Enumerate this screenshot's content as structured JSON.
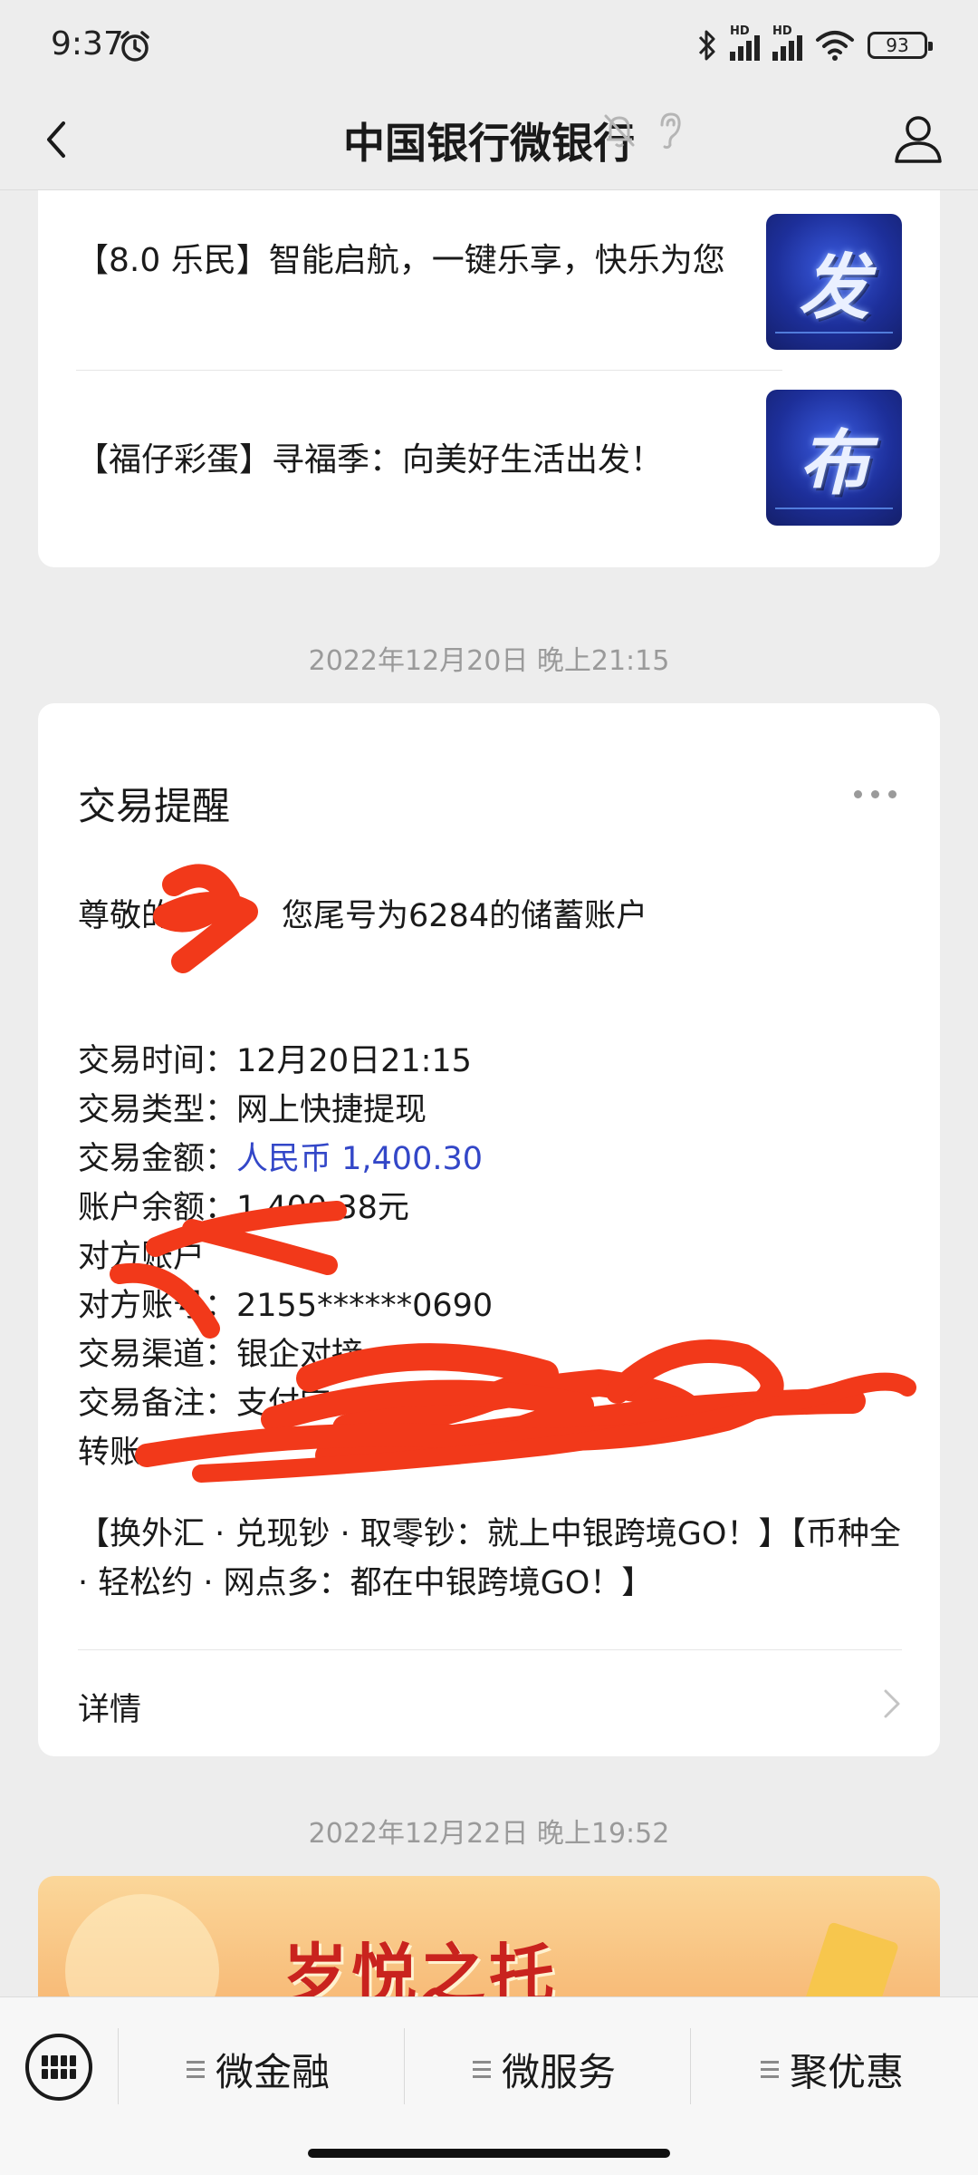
{
  "status_bar": {
    "time": "9:37",
    "signal_label_1": "HD",
    "signal_label_2": "HD",
    "battery": "93"
  },
  "header": {
    "title": "中国银行微银行"
  },
  "news": {
    "items": [
      {
        "title": "【8.0 乐民】智能启航，一键乐享，快乐为您",
        "thumb_glyph": "发"
      },
      {
        "title": "【福仔彩蛋】寻福季：向美好生活出发！",
        "thumb_glyph": "布"
      }
    ]
  },
  "timestamps": {
    "first": "2022年12月20日 晚上21:15",
    "second": "2022年12月22日 晚上19:52"
  },
  "transaction": {
    "title": "交易提醒",
    "greeting": "尊敬的……您尾号为6284的储蓄账户",
    "greeting_prefix": "尊敬的",
    "greeting_suffix": "您尾号为6284的储蓄账户",
    "time_label": "交易时间：",
    "time_value": "12月20日21:15",
    "type_label": "交易类型：",
    "type_value": "网上快捷提现",
    "amount_label": "交易金额：",
    "amount_value": "人民币 1,400.30",
    "balance_label": "账户余额：",
    "balance_value": "1,400.38元",
    "counterparty_label": "对方账户",
    "counterparty_no_label": "对方账号：",
    "counterparty_no_value": "2155******0690",
    "channel_label": "交易渠道：",
    "channel_value": "银企对接",
    "remark_label": "交易备注：",
    "remark_value": "支付宝",
    "remark_tail": "转账",
    "promo": "【换外汇 · 兑现钞 · 取零钞：就上中银跨境GO！】【币种全 · 轻松约 · 网点多：都在中银跨境GO！】",
    "detail_label": "详情"
  },
  "banner": {
    "title": "岁悦之托"
  },
  "bottom_nav": {
    "items": [
      {
        "label": "微金融"
      },
      {
        "label": "微服务"
      },
      {
        "label": "聚优惠"
      }
    ]
  },
  "colors": {
    "background": "#ededed",
    "amount_blue": "#3347c8",
    "redaction_red": "#f2391a"
  }
}
